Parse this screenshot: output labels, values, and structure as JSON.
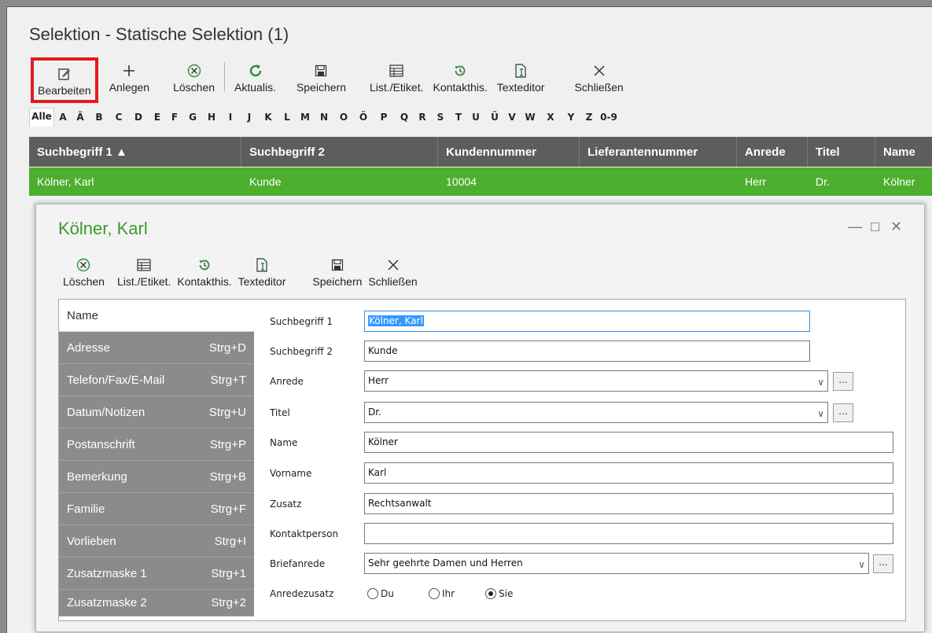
{
  "window": {
    "title": "Selektion - Statische Selektion (1)"
  },
  "toolbar": [
    {
      "key": "bearbeiten",
      "label": "Bearbeiten",
      "icon": "edit-icon"
    },
    {
      "key": "anlegen",
      "label": "Anlegen",
      "icon": "plus-icon"
    },
    {
      "key": "loeschen",
      "label": "Löschen",
      "icon": "delete-icon"
    },
    {
      "key": "aktualis",
      "label": "Aktualis.",
      "icon": "refresh-icon"
    },
    {
      "key": "speichern",
      "label": "Speichern",
      "icon": "save-icon"
    },
    {
      "key": "list-etiket",
      "label": "List./Etiket.",
      "icon": "list-icon"
    },
    {
      "key": "kontakthis",
      "label": "Kontakthis.",
      "icon": "history-icon"
    },
    {
      "key": "texteditor",
      "label": "Texteditor",
      "icon": "texteditor-icon"
    },
    {
      "key": "schliessen",
      "label": "Schließen",
      "icon": "close-icon"
    }
  ],
  "alphabet": [
    "Alle",
    "A",
    "Ä",
    "B",
    "C",
    "D",
    "E",
    "F",
    "G",
    "H",
    "I",
    "J",
    "K",
    "L",
    "M",
    "N",
    "O",
    "Ö",
    "P",
    "Q",
    "R",
    "S",
    "T",
    "U",
    "Ü",
    "V",
    "W",
    "X",
    "Y",
    "Z",
    "0-9"
  ],
  "grid": {
    "columns": [
      "Suchbegriff 1 ▲",
      "Suchbegriff 2",
      "Kundennummer",
      "Lieferantennummer",
      "Anrede",
      "Titel",
      "Name"
    ],
    "rows": [
      [
        "Kölner, Karl",
        "Kunde",
        "10004",
        "",
        "Herr",
        "Dr.",
        "Kölner"
      ]
    ]
  },
  "dialog": {
    "title": "Kölner, Karl",
    "toolbar": [
      {
        "key": "loeschen",
        "label": "Löschen",
        "icon": "delete-icon"
      },
      {
        "key": "list-etiket",
        "label": "List./Etiket.",
        "icon": "list-icon"
      },
      {
        "key": "kontakthis",
        "label": "Kontakthis.",
        "icon": "history-icon"
      },
      {
        "key": "texteditor",
        "label": "Texteditor",
        "icon": "texteditor-icon"
      },
      {
        "key": "speichern",
        "label": "Speichern",
        "icon": "save-icon"
      },
      {
        "key": "schliessen",
        "label": "Schließen",
        "icon": "close-icon"
      }
    ],
    "nav": [
      {
        "label": "Name",
        "shortcut": ""
      },
      {
        "label": "Adresse",
        "shortcut": "Strg+D"
      },
      {
        "label": "Telefon/Fax/E-Mail",
        "shortcut": "Strg+T"
      },
      {
        "label": "Datum/Notizen",
        "shortcut": "Strg+U"
      },
      {
        "label": "Postanschrift",
        "shortcut": "Strg+P"
      },
      {
        "label": "Bemerkung",
        "shortcut": "Strg+B"
      },
      {
        "label": "Familie",
        "shortcut": "Strg+F"
      },
      {
        "label": "Vorlieben",
        "shortcut": "Strg+I"
      },
      {
        "label": "Zusatzmaske 1",
        "shortcut": "Strg+1"
      },
      {
        "label": "Zusatzmaske 2",
        "shortcut": "Strg+2"
      }
    ],
    "form": {
      "suchbegriff1": {
        "label": "Suchbegriff 1",
        "value": "Kölner, Karl"
      },
      "suchbegriff2": {
        "label": "Suchbegriff 2",
        "value": "Kunde"
      },
      "anrede": {
        "label": "Anrede",
        "value": "Herr"
      },
      "titel": {
        "label": "Titel",
        "value": "Dr."
      },
      "name": {
        "label": "Name",
        "value": "Kölner"
      },
      "vorname": {
        "label": "Vorname",
        "value": "Karl"
      },
      "zusatz": {
        "label": "Zusatz",
        "value": "Rechtsanwalt"
      },
      "kontaktperson": {
        "label": "Kontaktperson",
        "value": ""
      },
      "briefanrede": {
        "label": "Briefanrede",
        "value": "Sehr geehrte Damen und Herren"
      },
      "anredezusatz": {
        "label": "Anredezusatz",
        "options": [
          "Du",
          "Ihr",
          "Sie"
        ],
        "selected": "Sie"
      },
      "dots_label": "..."
    }
  }
}
